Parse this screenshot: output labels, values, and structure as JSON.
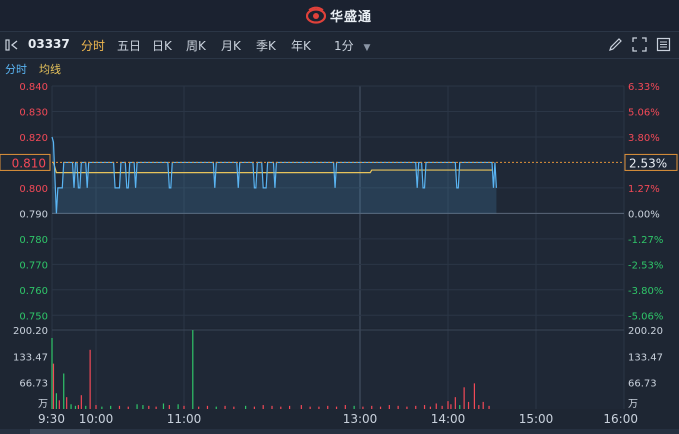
{
  "header": {
    "brand": "华盛通",
    "logo_icon": "eye-swirl-logo-icon",
    "brand_color": "#e0413a"
  },
  "toolbar": {
    "code": "03337",
    "tabs": [
      "分时",
      "五日",
      "日K",
      "周K",
      "月K",
      "季K",
      "年K"
    ],
    "active_tab": "分时",
    "period": "1分",
    "icons": [
      "draw-pen-icon",
      "fullscreen-icon",
      "settings-icon"
    ]
  },
  "subbar": {
    "tab_time": "分时",
    "avg_line": "均线"
  },
  "colors": {
    "up": "#f24957",
    "down": "#2fc569",
    "price_line": "#5ab4f2",
    "avg_line": "#e7c35b",
    "accent": "#f0b84f"
  },
  "chart_data": {
    "type": "line",
    "price": {
      "ylim": [
        0.745,
        0.84
      ],
      "left_ticks": [
        "0.840",
        "0.830",
        "0.820",
        "0.800",
        "0.790",
        "0.780",
        "0.770",
        "0.760",
        "0.750"
      ],
      "right_ticks": [
        "6.33%",
        "5.06%",
        "3.80%",
        "1.27%",
        "0.00%",
        "-1.27%",
        "-2.53%",
        "-3.80%",
        "-5.06%"
      ],
      "prev_close": 0.79,
      "current_price": "0.810",
      "current_pct": "2.53%",
      "x_ticks": [
        "9:30",
        "10:00",
        "11:00",
        "13:00",
        "14:00",
        "15:00",
        "16:00"
      ],
      "series": [
        {
          "values": [
            0.82,
            0.818,
            0.804,
            0.79,
            0.8,
            0.8,
            0.8,
            0.8,
            0.81,
            0.81,
            0.81,
            0.81,
            0.81,
            0.81,
            0.81,
            0.8,
            0.81,
            0.81,
            0.8,
            0.8,
            0.81,
            0.81,
            0.81,
            0.81,
            0.8,
            0.81,
            0.81,
            0.81,
            0.81,
            0.81,
            0.81,
            0.81,
            0.81,
            0.81,
            0.81,
            0.81,
            0.81,
            0.81,
            0.81,
            0.81,
            0.81,
            0.81,
            0.81,
            0.8,
            0.8,
            0.8,
            0.8,
            0.81,
            0.81,
            0.81,
            0.81,
            0.8,
            0.8,
            0.81,
            0.81,
            0.81,
            0.81,
            0.8,
            0.81,
            0.81,
            0.81,
            0.81,
            0.81,
            0.81,
            0.81,
            0.81,
            0.81,
            0.81,
            0.81,
            0.81,
            0.81,
            0.81,
            0.81,
            0.81,
            0.81,
            0.81,
            0.81,
            0.81,
            0.81,
            0.81,
            0.8,
            0.8,
            0.81,
            0.81,
            0.81,
            0.81,
            0.81,
            0.81,
            0.81,
            0.81,
            0.81,
            0.81,
            0.81,
            0.81,
            0.81,
            0.81,
            0.81,
            0.81,
            0.81,
            0.81,
            0.81,
            0.81,
            0.81,
            0.81,
            0.81,
            0.81,
            0.81,
            0.81,
            0.81,
            0.81,
            0.81,
            0.8,
            0.81,
            0.81,
            0.81,
            0.81,
            0.81,
            0.81,
            0.81,
            0.81,
            0.81,
            0.81,
            0.81,
            0.81,
            0.81,
            0.81,
            0.81,
            0.8,
            0.81,
            0.81,
            0.81,
            0.81,
            0.81,
            0.81,
            0.81,
            0.81,
            0.81,
            0.81,
            0.8,
            0.8,
            0.81,
            0.81,
            0.81,
            0.81,
            0.8,
            0.8,
            0.8,
            0.81,
            0.81,
            0.81,
            0.81,
            0.81,
            0.8,
            0.81,
            0.81,
            0.81,
            0.81,
            0.81,
            0.81,
            0.81,
            0.81,
            0.81,
            0.81,
            0.81,
            0.81,
            0.81,
            0.81,
            0.81,
            0.81,
            0.81,
            0.81,
            0.81,
            0.81,
            0.81,
            0.81,
            0.81,
            0.81,
            0.81,
            0.81,
            0.81,
            0.81,
            0.81,
            0.81,
            0.81,
            0.81,
            0.81,
            0.81,
            0.81,
            0.81,
            0.81,
            0.81,
            0.81,
            0.81,
            0.8,
            0.81,
            0.81,
            0.81,
            0.81,
            0.81,
            0.81,
            0.81,
            0.81,
            0.81,
            0.81,
            0.81,
            0.81,
            0.81,
            0.81,
            0.81,
            0.81,
            0.81,
            0.81,
            0.81,
            0.81,
            0.81,
            0.81,
            0.81,
            0.81,
            0.81,
            0.81,
            0.81,
            0.81,
            0.81,
            0.81,
            0.81,
            0.81,
            0.81,
            0.81,
            0.81,
            0.81,
            0.81,
            0.81,
            0.81,
            0.81,
            0.81,
            0.81,
            0.81,
            0.81,
            0.81,
            0.81,
            0.81,
            0.81,
            0.81,
            0.81,
            0.81,
            0.81,
            0.81,
            0.81,
            0.81,
            0.8,
            0.81,
            0.81,
            0.81,
            0.8,
            0.8,
            0.81,
            0.81,
            0.81,
            0.81,
            0.81,
            0.81,
            0.81,
            0.81,
            0.81,
            0.81,
            0.81,
            0.81,
            0.81,
            0.81,
            0.81,
            0.81,
            0.81,
            0.81,
            0.81,
            0.81,
            0.81,
            0.8,
            0.8,
            0.81,
            0.81,
            0.81,
            0.81,
            0.81,
            0.81,
            0.81,
            0.81,
            0.81,
            0.81,
            0.81,
            0.81,
            0.81,
            0.81,
            0.81,
            0.81,
            0.81,
            0.81,
            0.81,
            0.81,
            0.81,
            0.81,
            0.81,
            0.8,
            0.81,
            0.8
          ]
        },
        {
          "values": [
            0.81,
            0.81,
            0.808,
            0.806,
            0.806,
            0.806,
            0.806,
            0.806,
            0.806,
            0.806,
            0.806,
            0.806,
            0.806,
            0.806,
            0.806,
            0.806,
            0.806,
            0.806,
            0.806,
            0.806,
            0.806,
            0.806,
            0.806,
            0.806,
            0.806,
            0.806,
            0.806,
            0.806,
            0.806,
            0.806,
            0.806,
            0.806,
            0.806,
            0.806,
            0.806,
            0.806,
            0.806,
            0.806,
            0.806,
            0.806,
            0.806,
            0.806,
            0.806,
            0.806,
            0.806,
            0.806,
            0.806,
            0.806,
            0.806,
            0.806,
            0.806,
            0.806,
            0.806,
            0.806,
            0.806,
            0.806,
            0.806,
            0.806,
            0.806,
            0.806,
            0.806,
            0.806,
            0.806,
            0.806,
            0.806,
            0.806,
            0.806,
            0.806,
            0.806,
            0.806,
            0.806,
            0.806,
            0.806,
            0.806,
            0.806,
            0.806,
            0.806,
            0.806,
            0.806,
            0.806,
            0.806,
            0.806,
            0.806,
            0.806,
            0.806,
            0.806,
            0.806,
            0.806,
            0.806,
            0.806,
            0.806,
            0.806,
            0.806,
            0.806,
            0.806,
            0.806,
            0.806,
            0.806,
            0.806,
            0.806,
            0.806,
            0.806,
            0.806,
            0.806,
            0.806,
            0.806,
            0.806,
            0.806,
            0.806,
            0.806,
            0.806,
            0.806,
            0.806,
            0.806,
            0.806,
            0.806,
            0.806,
            0.806,
            0.806,
            0.806,
            0.806,
            0.806,
            0.806,
            0.806,
            0.806,
            0.806,
            0.806,
            0.806,
            0.806,
            0.806,
            0.806,
            0.806,
            0.806,
            0.806,
            0.806,
            0.806,
            0.806,
            0.806,
            0.806,
            0.806,
            0.806,
            0.806,
            0.806,
            0.806,
            0.806,
            0.806,
            0.806,
            0.806,
            0.806,
            0.806,
            0.806,
            0.806,
            0.806,
            0.806,
            0.806,
            0.806,
            0.806,
            0.806,
            0.806,
            0.806,
            0.806,
            0.806,
            0.806,
            0.806,
            0.806,
            0.806,
            0.806,
            0.806,
            0.806,
            0.806,
            0.806,
            0.806,
            0.806,
            0.806,
            0.806,
            0.806,
            0.806,
            0.806,
            0.806,
            0.806,
            0.806,
            0.806,
            0.806,
            0.806,
            0.806,
            0.806,
            0.806,
            0.806,
            0.806,
            0.806,
            0.806,
            0.806,
            0.806,
            0.806,
            0.806,
            0.806,
            0.806,
            0.806,
            0.806,
            0.806,
            0.806,
            0.806,
            0.806,
            0.806,
            0.806,
            0.806,
            0.806,
            0.806,
            0.806,
            0.806,
            0.806,
            0.806,
            0.806,
            0.806,
            0.806,
            0.806,
            0.806,
            0.806,
            0.807,
            0.807,
            0.807,
            0.807,
            0.807,
            0.807,
            0.807,
            0.807,
            0.807,
            0.807,
            0.807,
            0.807,
            0.807,
            0.807,
            0.807,
            0.807,
            0.807,
            0.807,
            0.807,
            0.807,
            0.807,
            0.807,
            0.807,
            0.807,
            0.807,
            0.807,
            0.807,
            0.807,
            0.807,
            0.807,
            0.807,
            0.807,
            0.807,
            0.807,
            0.807,
            0.807,
            0.807,
            0.807,
            0.807,
            0.807,
            0.807,
            0.807,
            0.807,
            0.807,
            0.807,
            0.807,
            0.807,
            0.807,
            0.807,
            0.807,
            0.807,
            0.807,
            0.807,
            0.807,
            0.807,
            0.807,
            0.807,
            0.807,
            0.807,
            0.807,
            0.807,
            0.807,
            0.807,
            0.807,
            0.807,
            0.807,
            0.807,
            0.807,
            0.807,
            0.807,
            0.807,
            0.807,
            0.807,
            0.807,
            0.807,
            0.807,
            0.807,
            0.807,
            0.807,
            0.807,
            0.807,
            0.807,
            0.807
          ]
        }
      ]
    },
    "volume": {
      "ylim": [
        0,
        200.2
      ],
      "ticks": [
        "200.20",
        "133.47",
        "66.73"
      ],
      "unit": "万",
      "bars": [
        {
          "i": 0,
          "v": 180,
          "c": "down"
        },
        {
          "i": 1,
          "v": 115,
          "c": "up"
        },
        {
          "i": 3,
          "v": 40,
          "c": "down"
        },
        {
          "i": 5,
          "v": 22,
          "c": "up"
        },
        {
          "i": 8,
          "v": 90,
          "c": "down"
        },
        {
          "i": 10,
          "v": 30,
          "c": "up"
        },
        {
          "i": 13,
          "v": 12,
          "c": "down"
        },
        {
          "i": 16,
          "v": 8,
          "c": "down"
        },
        {
          "i": 18,
          "v": 10,
          "c": "up"
        },
        {
          "i": 20,
          "v": 35,
          "c": "up"
        },
        {
          "i": 23,
          "v": 8,
          "c": "down"
        },
        {
          "i": 26,
          "v": 150,
          "c": "up"
        },
        {
          "i": 30,
          "v": 10,
          "c": "up"
        },
        {
          "i": 34,
          "v": 6,
          "c": "down"
        },
        {
          "i": 40,
          "v": 8,
          "c": "down"
        },
        {
          "i": 46,
          "v": 8,
          "c": "up"
        },
        {
          "i": 52,
          "v": 6,
          "c": "up"
        },
        {
          "i": 58,
          "v": 12,
          "c": "down"
        },
        {
          "i": 62,
          "v": 10,
          "c": "down"
        },
        {
          "i": 66,
          "v": 8,
          "c": "up"
        },
        {
          "i": 71,
          "v": 6,
          "c": "up"
        },
        {
          "i": 76,
          "v": 14,
          "c": "down"
        },
        {
          "i": 80,
          "v": 10,
          "c": "up"
        },
        {
          "i": 86,
          "v": 12,
          "c": "down"
        },
        {
          "i": 90,
          "v": 8,
          "c": "up"
        },
        {
          "i": 96,
          "v": 200,
          "c": "down"
        },
        {
          "i": 100,
          "v": 6,
          "c": "up"
        },
        {
          "i": 106,
          "v": 8,
          "c": "up"
        },
        {
          "i": 112,
          "v": 6,
          "c": "down"
        },
        {
          "i": 118,
          "v": 8,
          "c": "up"
        },
        {
          "i": 124,
          "v": 6,
          "c": "up"
        },
        {
          "i": 132,
          "v": 8,
          "c": "down"
        },
        {
          "i": 138,
          "v": 6,
          "c": "up"
        },
        {
          "i": 144,
          "v": 10,
          "c": "up"
        },
        {
          "i": 150,
          "v": 8,
          "c": "up"
        },
        {
          "i": 156,
          "v": 6,
          "c": "up"
        },
        {
          "i": 162,
          "v": 8,
          "c": "up"
        },
        {
          "i": 170,
          "v": 10,
          "c": "up"
        },
        {
          "i": 176,
          "v": 6,
          "c": "up"
        },
        {
          "i": 182,
          "v": 6,
          "c": "up"
        },
        {
          "i": 188,
          "v": 8,
          "c": "up"
        },
        {
          "i": 194,
          "v": 6,
          "c": "up"
        },
        {
          "i": 200,
          "v": 10,
          "c": "up"
        },
        {
          "i": 206,
          "v": 8,
          "c": "down"
        },
        {
          "i": 212,
          "v": 6,
          "c": "up"
        },
        {
          "i": 218,
          "v": 8,
          "c": "up"
        },
        {
          "i": 224,
          "v": 6,
          "c": "up"
        },
        {
          "i": 230,
          "v": 10,
          "c": "up"
        },
        {
          "i": 236,
          "v": 8,
          "c": "up"
        },
        {
          "i": 242,
          "v": 6,
          "c": "up"
        },
        {
          "i": 248,
          "v": 8,
          "c": "up"
        },
        {
          "i": 254,
          "v": 10,
          "c": "up"
        },
        {
          "i": 258,
          "v": 6,
          "c": "up"
        },
        {
          "i": 262,
          "v": 14,
          "c": "up"
        },
        {
          "i": 266,
          "v": 8,
          "c": "up"
        },
        {
          "i": 270,
          "v": 20,
          "c": "up"
        },
        {
          "i": 272,
          "v": 12,
          "c": "up"
        },
        {
          "i": 275,
          "v": 30,
          "c": "up"
        },
        {
          "i": 278,
          "v": 10,
          "c": "down"
        },
        {
          "i": 281,
          "v": 55,
          "c": "up"
        },
        {
          "i": 284,
          "v": 18,
          "c": "up"
        },
        {
          "i": 288,
          "v": 65,
          "c": "up"
        },
        {
          "i": 291,
          "v": 10,
          "c": "up"
        },
        {
          "i": 294,
          "v": 18,
          "c": "up"
        },
        {
          "i": 298,
          "v": 8,
          "c": "up"
        }
      ]
    }
  }
}
